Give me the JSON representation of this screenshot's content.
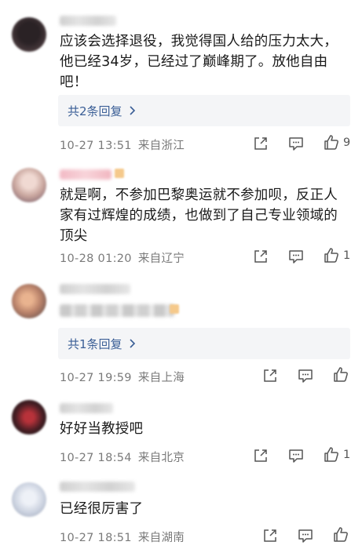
{
  "comments": [
    {
      "text": "应该会选择退役，我觉得国人给的压力太大，他已经34岁，已经过了巅峰期了。放他自由吧！",
      "reply_link": "共2条回复",
      "time": "10-27 13:51",
      "location": "来自浙江",
      "likes": "9"
    },
    {
      "text": "就是啊，不参加巴黎奥运就不参加呗，反正人家有过辉煌的成绩，也做到了自己专业领域的顶尖",
      "time": "10-28 01:20",
      "location": "来自辽宁",
      "likes": "1"
    },
    {
      "reply_link": "共1条回复",
      "time": "10-27 19:59",
      "location": "来自上海",
      "likes": ""
    },
    {
      "text": "好好当教授吧",
      "time": "10-27 18:54",
      "location": "来自北京",
      "likes": "1"
    },
    {
      "text": "已经很厉害了",
      "time": "10-27 18:51",
      "location": "来自湖南",
      "likes": ""
    }
  ],
  "icons": {
    "share": "share-icon",
    "comment": "comment-icon",
    "like": "thumbs-up-icon",
    "chevron": "chevron-right-icon"
  },
  "colors": {
    "link": "#3a5e96",
    "meta": "#7a7a7a",
    "reply_bg": "#f4f5f7"
  }
}
